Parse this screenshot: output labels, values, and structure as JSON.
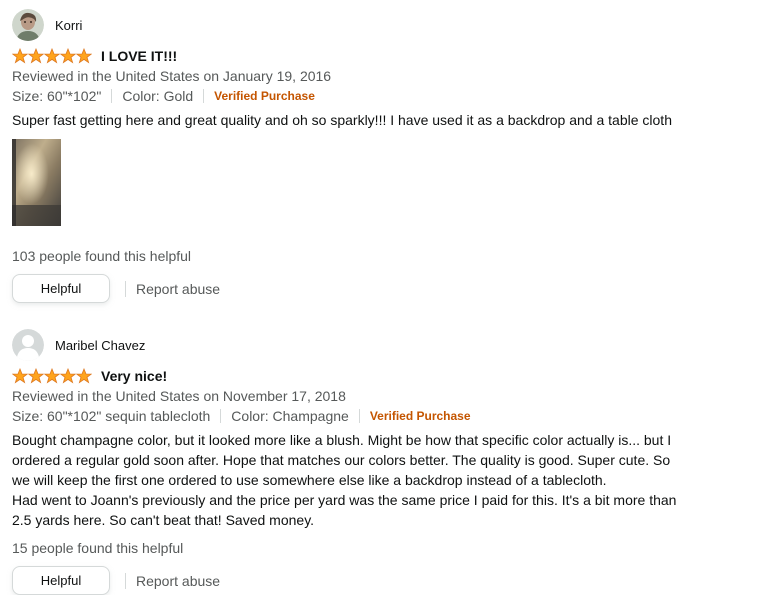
{
  "reviews": [
    {
      "profile_name": "Korri",
      "rating": 5,
      "title": "I LOVE IT!!!",
      "date_text": "Reviewed in the United States on January 19, 2016",
      "size_text": "Size: 60\"*102\"",
      "color_text": "Color: Gold",
      "verified_text": "Verified Purchase",
      "body": "Super fast getting here and great quality and oh so sparkly!!! I have used it as a backdrop and a table cloth",
      "helpful_count_text": "103 people found this helpful",
      "helpful_label": "Helpful",
      "report_label": "Report abuse"
    },
    {
      "profile_name": "Maribel Chavez",
      "rating": 5,
      "title": "Very nice!",
      "date_text": "Reviewed in the United States on November 17, 2018",
      "size_text": "Size: 60\"*102\" sequin tablecloth",
      "color_text": "Color: Champagne",
      "verified_text": "Verified Purchase",
      "body": "Bought champagne color, but it looked more like a blush. Might be how that specific color actually is... but I\nordered a regular gold soon after. Hope that matches our colors better. The quality is good. Super cute. So\nwe will keep the first one ordered to use somewhere else like a backdrop instead of a tablecloth.\nHad went to Joann's previously and the price per yard was the same price I paid for this. It's a bit more than\n2.5 yards here. So can't beat that! Saved money.",
      "helpful_count_text": "15 people found this helpful",
      "helpful_label": "Helpful",
      "report_label": "Report abuse"
    }
  ],
  "colors": {
    "star": "#ffa41c",
    "star_stroke": "#de7921",
    "verified": "#c45500",
    "muted_text": "#565959",
    "primary_text": "#0f1111"
  },
  "icons": {
    "avatar_1": "user-photo-avatar",
    "avatar_2": "default-user-avatar",
    "star": "star-icon"
  }
}
